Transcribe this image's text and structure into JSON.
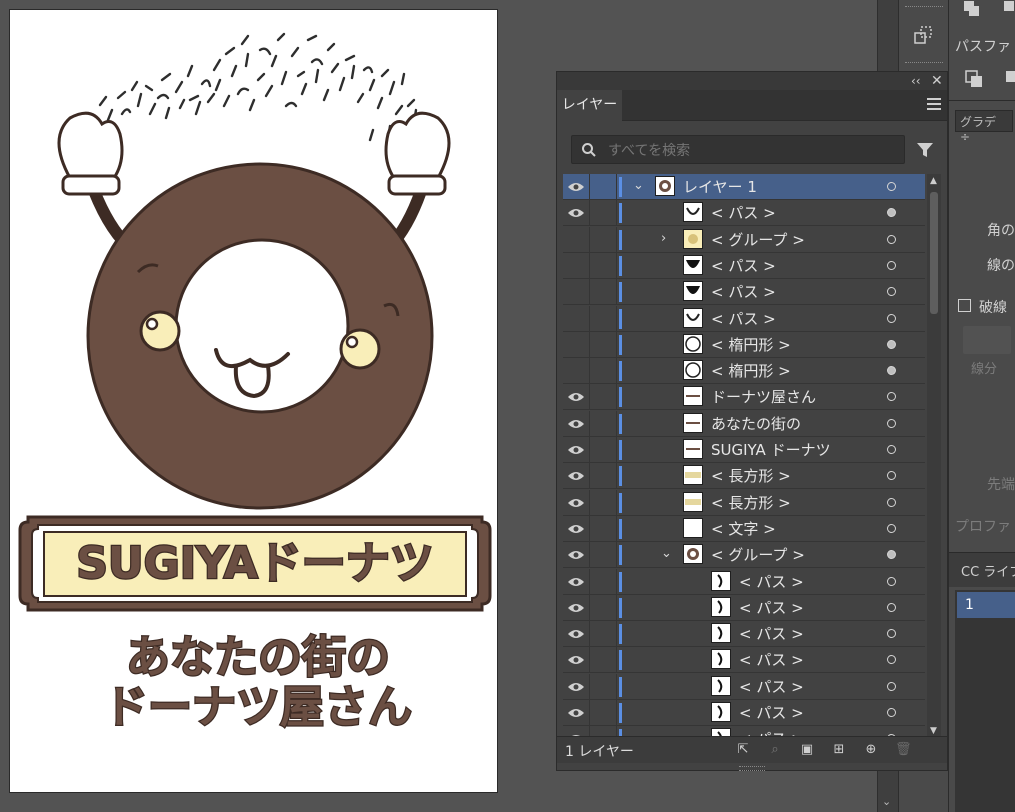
{
  "artboard": {
    "banner_text": "SUGIYAドーナツ",
    "tagline_line1": "あなたの街の",
    "tagline_line2": "ドーナツ屋さん"
  },
  "layers_panel": {
    "tab_label": "レイヤー",
    "search_placeholder": "すべてを検索",
    "footer_count": "1 レイヤー",
    "rows": [
      {
        "name": "レイヤー 1",
        "visible": true,
        "indent": 0,
        "expand": "open",
        "selected": true,
        "thumb": "donut",
        "target_filled": false
      },
      {
        "name": "< パス >",
        "visible": true,
        "indent": 1,
        "expand": "",
        "selected": false,
        "thumb": "arc",
        "target_filled": true
      },
      {
        "name": "< グループ >",
        "visible": false,
        "indent": 1,
        "expand": "closed",
        "selected": false,
        "thumb": "group",
        "target_filled": false
      },
      {
        "name": "< パス >",
        "visible": false,
        "indent": 1,
        "expand": "",
        "selected": false,
        "thumb": "bowl",
        "target_filled": false
      },
      {
        "name": "< パス >",
        "visible": false,
        "indent": 1,
        "expand": "",
        "selected": false,
        "thumb": "bowl",
        "target_filled": false
      },
      {
        "name": "< パス >",
        "visible": false,
        "indent": 1,
        "expand": "",
        "selected": false,
        "thumb": "arc",
        "target_filled": false
      },
      {
        "name": "< 楕円形 >",
        "visible": false,
        "indent": 1,
        "expand": "",
        "selected": false,
        "thumb": "circle",
        "target_filled": true
      },
      {
        "name": "< 楕円形 >",
        "visible": false,
        "indent": 1,
        "expand": "",
        "selected": false,
        "thumb": "circle",
        "target_filled": true
      },
      {
        "name": "ドーナツ屋さん",
        "visible": true,
        "indent": 1,
        "expand": "",
        "selected": false,
        "thumb": "text",
        "target_filled": false
      },
      {
        "name": "あなたの街の",
        "visible": true,
        "indent": 1,
        "expand": "",
        "selected": false,
        "thumb": "text",
        "target_filled": false
      },
      {
        "name": "SUGIYA ドーナツ",
        "visible": true,
        "indent": 1,
        "expand": "",
        "selected": false,
        "thumb": "text",
        "target_filled": false
      },
      {
        "name": "< 長方形 >",
        "visible": true,
        "indent": 1,
        "expand": "",
        "selected": false,
        "thumb": "rect",
        "target_filled": false
      },
      {
        "name": "< 長方形 >",
        "visible": true,
        "indent": 1,
        "expand": "",
        "selected": false,
        "thumb": "rect",
        "target_filled": false
      },
      {
        "name": "< 文字 >",
        "visible": true,
        "indent": 1,
        "expand": "",
        "selected": false,
        "thumb": "blank",
        "target_filled": false
      },
      {
        "name": "< グループ >",
        "visible": true,
        "indent": 1,
        "expand": "open",
        "selected": false,
        "thumb": "donut",
        "target_filled": true
      },
      {
        "name": "< パス >",
        "visible": true,
        "indent": 2,
        "expand": "",
        "selected": false,
        "thumb": "curve",
        "target_filled": false
      },
      {
        "name": "< パス >",
        "visible": true,
        "indent": 2,
        "expand": "",
        "selected": false,
        "thumb": "curve",
        "target_filled": false
      },
      {
        "name": "< パス >",
        "visible": true,
        "indent": 2,
        "expand": "",
        "selected": false,
        "thumb": "curve",
        "target_filled": false
      },
      {
        "name": "< パス >",
        "visible": true,
        "indent": 2,
        "expand": "",
        "selected": false,
        "thumb": "curve",
        "target_filled": false
      },
      {
        "name": "< パス >",
        "visible": true,
        "indent": 2,
        "expand": "",
        "selected": false,
        "thumb": "curve",
        "target_filled": false
      },
      {
        "name": "< パス >",
        "visible": true,
        "indent": 2,
        "expand": "",
        "selected": false,
        "thumb": "curve",
        "target_filled": false
      },
      {
        "name": "< パス >",
        "visible": true,
        "indent": 2,
        "expand": "",
        "selected": false,
        "thumb": "curve",
        "target_filled": false
      }
    ]
  },
  "properties_panel": {
    "pathfinder_label": "パスファ",
    "gradient_select": "グラデ",
    "corner_label": "角の",
    "stroke_label": "線の",
    "dashed_label": "破線",
    "segment_label": "線分",
    "tip_label": "先端",
    "profile_label": "プロファ",
    "cc_library_label": "CC ライブ",
    "cc_item": "1"
  },
  "colors": {
    "donut_brown": "#6b4f43",
    "outline": "#3d2b24",
    "cream": "#f9eeb9",
    "selection_blue": "#46608a",
    "layer_bar_blue": "#5b8fe4"
  }
}
